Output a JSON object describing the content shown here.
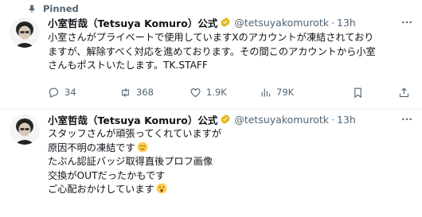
{
  "pinned_label": "Pinned",
  "tweets": [
    {
      "author": "小室哲哉（Tetsuya Komuro）公式",
      "handle": "@tetsuyakomurotk",
      "time": "13h",
      "lines": [
        "小室さんがプライベートで使用していますXのアカウントが凍結されており",
        "ますが、解除すべく対応を進めております。その間このアカウントから小室",
        "さんもポストいたします。TK.STAFF"
      ],
      "stats": {
        "replies": "34",
        "reposts": "368",
        "likes": "1.9K",
        "views": "79K"
      }
    },
    {
      "author": "小室哲哉（Tetsuya Komuro）公式",
      "handle": "@tetsuyakomurotk",
      "time": "13h",
      "lines": [
        "スタッフさんが頑張ってくれていますが",
        "原因不明の凍結です",
        "たぶん認証バッジ取得直後プロフ画像",
        "交換がOUTだったかもです",
        "ご心配おかけしています"
      ]
    }
  ],
  "colors": {
    "text": "#0f1419",
    "secondary": "#536471",
    "verified_gold": "#e2b719",
    "divider": "#eff3f4"
  },
  "icons": [
    "pin-icon",
    "verified-badge-icon",
    "more-icon",
    "reply-icon",
    "repost-icon",
    "like-icon",
    "views-icon",
    "bookmark-icon",
    "share-icon",
    "relieved-face-emoji",
    "hushed-face-emoji"
  ]
}
